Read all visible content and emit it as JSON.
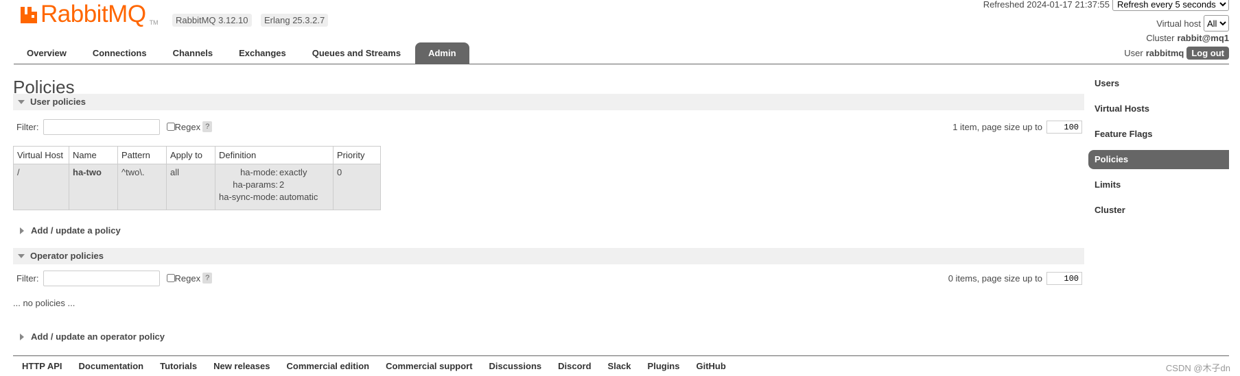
{
  "header": {
    "logo_text": "RabbitMQ",
    "logo_tm": "TM",
    "rabbitmq_version": "RabbitMQ 3.12.10",
    "erlang_version": "Erlang 25.3.2.7",
    "refreshed_label": "Refreshed 2024-01-17 21:37:55",
    "refresh_option": "Refresh every 5 seconds",
    "vhost_label": "Virtual host",
    "vhost_value": "All",
    "cluster_label": "Cluster",
    "cluster_value": "rabbit@mq1",
    "user_label": "User",
    "user_value": "rabbitmq",
    "logout_label": "Log out"
  },
  "tabs": [
    {
      "label": "Overview"
    },
    {
      "label": "Connections"
    },
    {
      "label": "Channels"
    },
    {
      "label": "Exchanges"
    },
    {
      "label": "Queues and Streams"
    },
    {
      "label": "Admin",
      "active": true
    }
  ],
  "main": {
    "title": "Policies",
    "user_policies": {
      "heading": "User policies",
      "filter_label": "Filter:",
      "filter_value": "",
      "regex_label": "Regex",
      "help": "?",
      "page_info": "1 item, page size up to",
      "page_size": "100",
      "columns": [
        "Virtual Host",
        "Name",
        "Pattern",
        "Apply to",
        "Definition",
        "Priority"
      ],
      "rows": [
        {
          "vhost": "/",
          "name": "ha-two",
          "pattern": "^two\\.",
          "apply_to": "all",
          "definition": [
            {
              "key": "ha-mode:",
              "value": "exactly"
            },
            {
              "key": "ha-params:",
              "value": "2"
            },
            {
              "key": "ha-sync-mode:",
              "value": "automatic"
            }
          ],
          "priority": "0"
        }
      ],
      "add_label": "Add / update a policy"
    },
    "operator_policies": {
      "heading": "Operator policies",
      "filter_label": "Filter:",
      "filter_value": "",
      "regex_label": "Regex",
      "help": "?",
      "page_info": "0 items, page size up to",
      "page_size": "100",
      "empty_text": "... no policies ...",
      "add_label": "Add / update an operator policy"
    }
  },
  "side_nav": [
    {
      "label": "Users"
    },
    {
      "label": "Virtual Hosts"
    },
    {
      "label": "Feature Flags"
    },
    {
      "label": "Policies",
      "active": true
    },
    {
      "label": "Limits"
    },
    {
      "label": "Cluster"
    }
  ],
  "footer": {
    "links": [
      "HTTP API",
      "Documentation",
      "Tutorials",
      "New releases",
      "Commercial edition",
      "Commercial support",
      "Discussions",
      "Discord",
      "Slack",
      "Plugins",
      "GitHub"
    ],
    "watermark": "CSDN @木子dn"
  },
  "colors": {
    "brand": "#ff6600",
    "tab_active": "#666666",
    "row_bg": "#e6e6e6"
  }
}
